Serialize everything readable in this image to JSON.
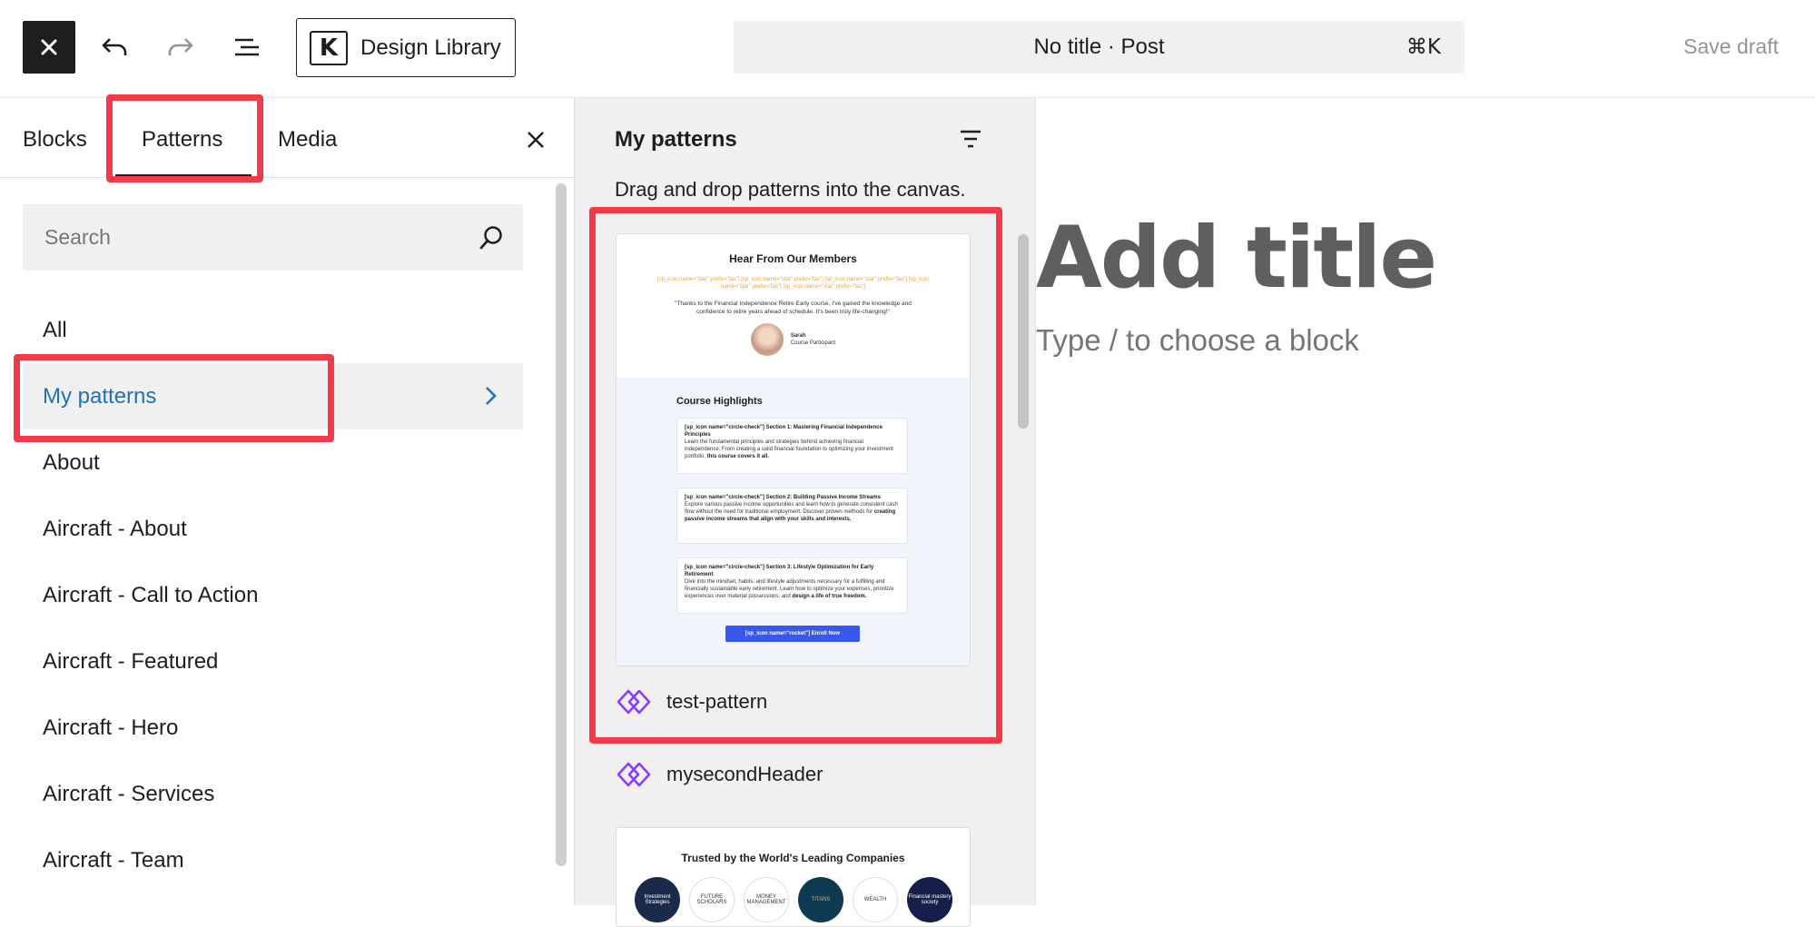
{
  "toolbar": {
    "design_library_label": "Design Library",
    "command_title": "No title · Post",
    "command_shortcut": "⌘K",
    "save_draft_label": "Save draft"
  },
  "inserter": {
    "tabs": [
      {
        "label": "Blocks"
      },
      {
        "label": "Patterns"
      },
      {
        "label": "Media"
      }
    ],
    "active_tab": "Patterns",
    "search_placeholder": "Search",
    "categories": [
      {
        "label": "All"
      },
      {
        "label": "My patterns"
      },
      {
        "label": "About"
      },
      {
        "label": "Aircraft - About"
      },
      {
        "label": "Aircraft - Call to Action"
      },
      {
        "label": "Aircraft - Featured"
      },
      {
        "label": "Aircraft - Hero"
      },
      {
        "label": "Aircraft - Services"
      },
      {
        "label": "Aircraft - Team"
      }
    ],
    "active_category": "My patterns"
  },
  "patterns_panel": {
    "title": "My patterns",
    "description": "Drag and drop patterns into the canvas.",
    "patterns": [
      {
        "label": "test-pattern"
      },
      {
        "label": "mysecondHeader"
      }
    ],
    "preview1": {
      "heading": "Hear From Our Members",
      "shortcodes": "[sp_icon name=\"star\" prefix=\"fas\"] [sp_icon name=\"star\" prefix=\"fas\"] [sp_icon name=\"star\" prefix=\"fas\"] [sp_icon name=\"star\" prefix=\"fas\"] [sp_icon name=\"star\" prefix=\"fas\"]",
      "quote": "\"Thanks to the Financial Independence Retire Early course, I've gained the knowledge and confidence to retire years ahead of schedule. It's been truly life-changing!\"",
      "person_name": "Sarah",
      "person_role": "Course Participant",
      "highlights_heading": "Course Highlights",
      "sections": [
        {
          "title": "[sp_icon name=\"circle-check\"] Section 1: Mastering Financial Independence Principles",
          "body": "Learn the fundamental principles and strategies behind achieving financial independence. From creating a solid financial foundation to optimizing your investment portfolio,",
          "bold_end": "this course covers it all."
        },
        {
          "title": "[sp_icon name=\"circle-check\"] Section 2: Building Passive Income Streams",
          "body": "Explore various passive income opportunities and learn how to generate consistent cash flow without the need for traditional employment. Discover proven methods for",
          "bold_end": "creating passive income streams that align with your skills and interests."
        },
        {
          "title": "[sp_icon name=\"circle-check\"] Section 3: Lifestyle Optimization for Early Retirement",
          "body": "Dive into the mindset, habits, and lifestyle adjustments necessary for a fulfilling and financially sustainable early retirement. Learn how to optimize your expenses, prioritize experiences over material possessions, and",
          "bold_end": "design a life of true freedom."
        }
      ],
      "enroll_label": "[sp_icon name=\"rocket\"] Enroll Now"
    },
    "preview2": {
      "heading": "Trusted by the World's Leading Companies",
      "logos": [
        {
          "label": "Investment Strategies",
          "color": "#1b2a4a"
        },
        {
          "label": "FUTURE SCHOLARS",
          "color": "#ffffff"
        },
        {
          "label": "MONEY MANAGEMENT",
          "color": "#ffffff"
        },
        {
          "label": "TITANS",
          "color": "#0f3b52"
        },
        {
          "label": "WEALTH",
          "color": "#ffffff"
        },
        {
          "label": "Financial mastery society",
          "color": "#14204a"
        }
      ]
    }
  },
  "canvas": {
    "title_placeholder": "Add title",
    "block_hint": "Type / to choose a block"
  },
  "colors": {
    "highlight": "#f23a4a",
    "active_link": "#2271b1",
    "pattern_icon": "#8b3dff"
  }
}
